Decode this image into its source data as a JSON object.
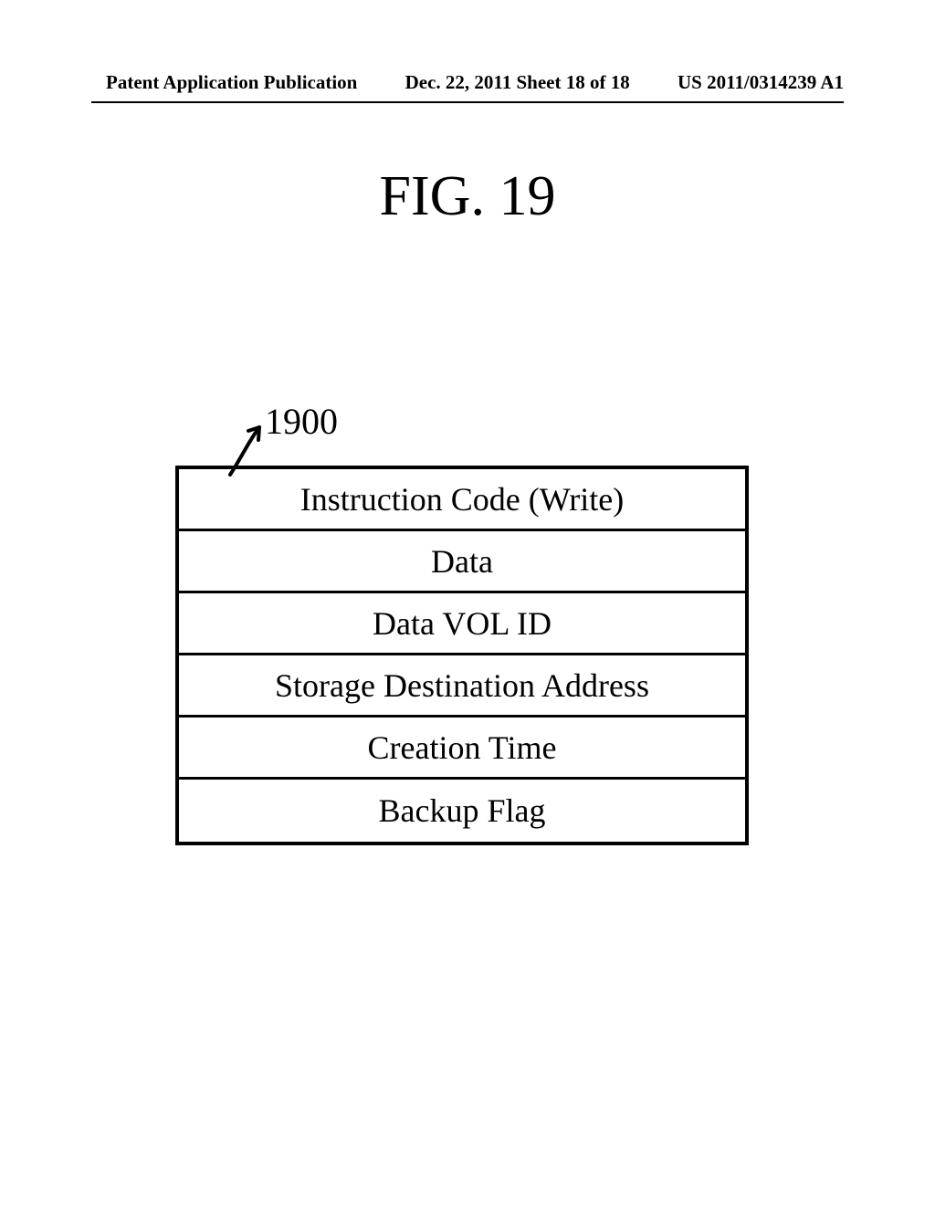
{
  "header": {
    "left": "Patent Application Publication",
    "center": "Dec. 22, 2011  Sheet 18 of 18",
    "right": "US 2011/0314239 A1"
  },
  "figure": {
    "title": "FIG. 19",
    "reference_number": "1900"
  },
  "table": {
    "rows": [
      "Instruction Code (Write)",
      "Data",
      "Data VOL ID",
      "Storage Destination Address",
      "Creation Time",
      "Backup Flag"
    ]
  }
}
